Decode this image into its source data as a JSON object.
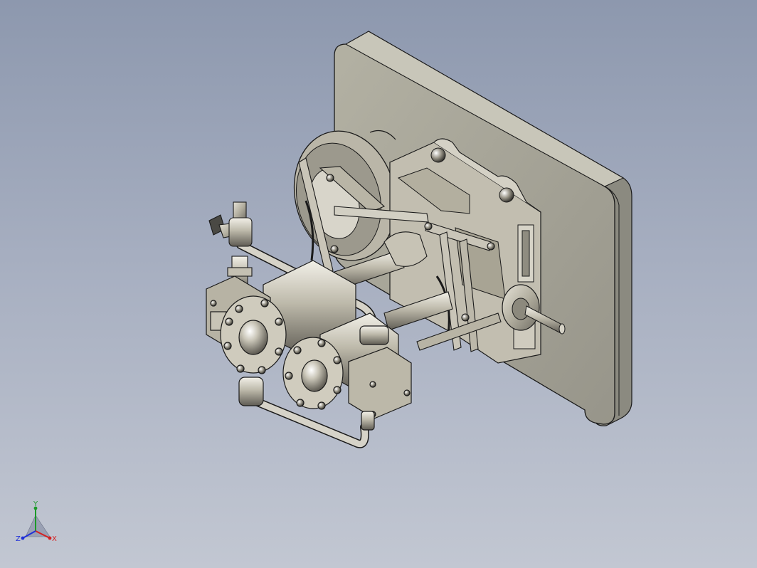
{
  "viewport": {
    "background_top": "#8d98ae",
    "background_bottom": "#c2c7d2"
  },
  "model": {
    "part_color": "#b8b4a4",
    "plate_color": "#a7a596",
    "edge_color": "#1a1a1a"
  },
  "triad": {
    "x_label": "X",
    "y_label": "Y",
    "z_label": "Z",
    "x_color": "#d42020",
    "y_color": "#1c9a2a",
    "z_color": "#2030d8"
  }
}
